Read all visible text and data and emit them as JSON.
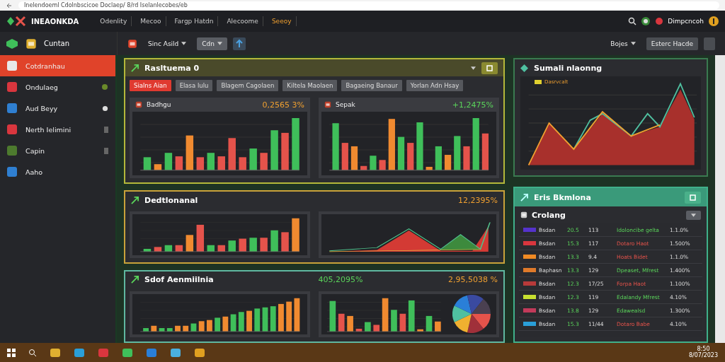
{
  "browser": {
    "url": "Inelendoeml Cdolnbscicoe Doclaep/ 8/rd Iselanlecobes/eb"
  },
  "app_bar": {
    "logo": "INEAONKDA",
    "nav": [
      {
        "label": "Odenlity",
        "selected": false
      },
      {
        "label": "Mecoo",
        "selected": false
      },
      {
        "label": "Fargp Hatdn",
        "selected": false
      },
      {
        "label": "Alecoome",
        "selected": false
      },
      {
        "label": "Seeoy",
        "selected": true
      }
    ],
    "user": "Dimpcncoh"
  },
  "sidebar": {
    "header": "Cuntan",
    "items": [
      {
        "label": "Cotdranhau",
        "selected": true,
        "color": "#e8e8e8",
        "kind": "plain"
      },
      {
        "label": "Ondulaeg",
        "selected": false,
        "color": "#d9363e",
        "kind": "ring"
      },
      {
        "label": "Aud Beyy",
        "selected": false,
        "color": "#2f7fd1",
        "kind": "dot"
      },
      {
        "label": "Nerth Ielimini",
        "selected": false,
        "color": "#d9363e",
        "kind": "square"
      },
      {
        "label": "Capin",
        "selected": false,
        "color": "#4d7a2e",
        "kind": "square"
      },
      {
        "label": "Aaho",
        "selected": false,
        "color": "#2f7fd1",
        "kind": "plain"
      }
    ]
  },
  "toolbar": {
    "left": [
      {
        "label": "Sinc Asild",
        "kind": "dropdown"
      },
      {
        "label": "Cdn",
        "kind": "select"
      }
    ],
    "right": [
      {
        "label": "Bojes",
        "kind": "dropdown"
      },
      {
        "label": "Esterc Hacde",
        "kind": "button"
      }
    ]
  },
  "panels": [
    {
      "title": "Rasltuema 0",
      "color": "#b4b83a",
      "tabs": [
        {
          "label": "Sialns Aian",
          "selected": true
        },
        {
          "label": "Elasa lulu",
          "selected": false
        },
        {
          "label": "Blagem Cagolaen",
          "selected": false
        },
        {
          "label": "Kiltela Maolaen",
          "selected": false
        },
        {
          "label": "Bagaeing Banaur",
          "selected": false
        },
        {
          "label": "Yorlan Adn Hsay",
          "selected": false
        }
      ],
      "cards": [
        {
          "title": "Badhgu",
          "value": "0,2565 3%",
          "positive": false,
          "kind": "bar"
        },
        {
          "title": "Sepak",
          "value": "+1,2475%",
          "positive": true,
          "kind": "bar"
        }
      ]
    },
    {
      "title": "Dedtlonanal",
      "color": "#c9a23a",
      "value": "12,2395%",
      "positive": false,
      "cards": [
        {
          "kind": "bar"
        },
        {
          "kind": "area"
        }
      ]
    },
    {
      "title": "Sdof Aenmiilnia",
      "color": "#5fb8a0",
      "value": "405,2095%",
      "positive": true,
      "value_2": "2,95,5038 %",
      "positive_2": false,
      "cards": [
        {
          "kind": "rising"
        },
        {
          "kind": "pie"
        }
      ]
    }
  ],
  "summary": {
    "title": "Sumali nlaonng",
    "legend": "Dasrvcalt"
  },
  "table_panel": {
    "title": "Eris Bkmlona",
    "subtitle": "Crolang",
    "rows": [
      {
        "color": "#5533cc",
        "name": "Bsdan",
        "c2": "20.5",
        "c3": "113",
        "c4": "Idoloncibe gelta",
        "c5": "1.1.0%",
        "positive": true
      },
      {
        "color": "#d9363e",
        "name": "Bsdan",
        "c2": "15.3",
        "c3": "117",
        "c4": "Dotaro Haot",
        "c5": "1.500%",
        "positive": false
      },
      {
        "color": "#f08a24",
        "name": "Bsdan",
        "c2": "13.3",
        "c3": "9.4",
        "c4": "Hoats Bidet",
        "c5": "1.1.0%",
        "positive": false
      },
      {
        "color": "#e07a2a",
        "name": "Baphasn",
        "c2": "13.3",
        "c3": "129",
        "c4": "Dpeaset, Mfrest",
        "c5": "1.400%",
        "positive": true
      },
      {
        "color": "#b83a3a",
        "name": "Bsdan",
        "c2": "12.3",
        "c3": "17/25",
        "c4": "Forpa Haot",
        "c5": "1.100%",
        "positive": false
      },
      {
        "color": "#c8e030",
        "name": "Bsdan",
        "c2": "12.3",
        "c3": "119",
        "c4": "Edalandy Mfrest",
        "c5": "4.10%",
        "positive": true
      },
      {
        "color": "#c23a5a",
        "name": "Bsdan",
        "c2": "13.8",
        "c3": "129",
        "c4": "Edawealsd",
        "c5": "1.300%",
        "positive": true
      },
      {
        "color": "#2a9fd8",
        "name": "Bsdan",
        "c2": "15.3",
        "c3": "11/44",
        "c4": "Dotaro Babe",
        "c5": "4.10%",
        "positive": false
      }
    ]
  },
  "taskbar": {
    "time": "8:50",
    "date": "8/07/2023"
  }
}
